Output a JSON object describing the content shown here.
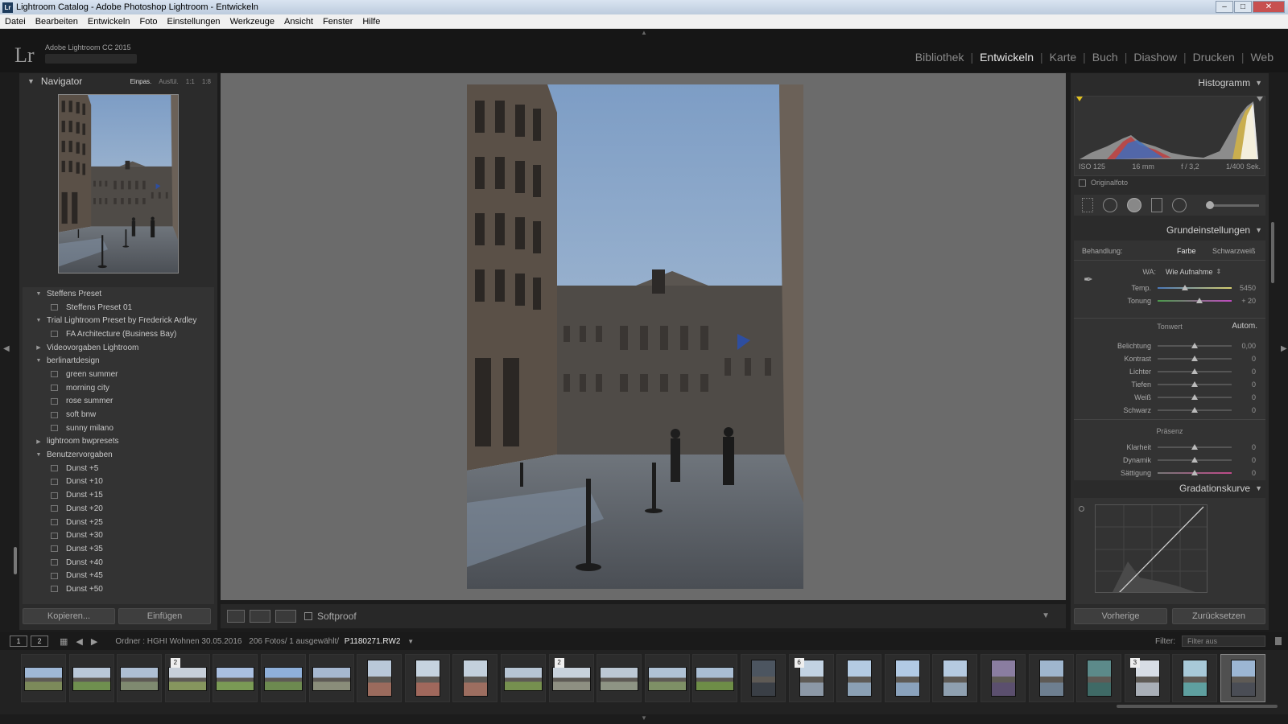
{
  "window": {
    "title": "Lightroom Catalog - Adobe Photoshop Lightroom - Entwickeln",
    "app_icon": "Lr"
  },
  "menu": [
    "Datei",
    "Bearbeiten",
    "Entwickeln",
    "Foto",
    "Einstellungen",
    "Werkzeuge",
    "Ansicht",
    "Fenster",
    "Hilfe"
  ],
  "identity": {
    "logo": "Lr",
    "version": "Adobe Lightroom CC 2015"
  },
  "modules": [
    {
      "label": "Bibliothek",
      "active": false
    },
    {
      "label": "Entwickeln",
      "active": true
    },
    {
      "label": "Karte",
      "active": false
    },
    {
      "label": "Buch",
      "active": false
    },
    {
      "label": "Diashow",
      "active": false
    },
    {
      "label": "Drucken",
      "active": false
    },
    {
      "label": "Web",
      "active": false
    }
  ],
  "navigator": {
    "title": "Navigator",
    "options": [
      "Einpas.",
      "Ausfül.",
      "1:1",
      "1:8"
    ]
  },
  "presets": [
    {
      "label": "Steffens Preset",
      "kind": "folder",
      "open": true
    },
    {
      "label": "Steffens Preset 01",
      "kind": "preset"
    },
    {
      "label": "Trial Lightroom Preset by Frederick Ardley",
      "kind": "folder",
      "open": true
    },
    {
      "label": "FA Architecture (Business Bay)",
      "kind": "preset"
    },
    {
      "label": "Videovorgaben Lightroom",
      "kind": "folder",
      "open": false
    },
    {
      "label": "berlinartdesign",
      "kind": "folder",
      "open": true
    },
    {
      "label": "green summer",
      "kind": "preset"
    },
    {
      "label": "morning city",
      "kind": "preset"
    },
    {
      "label": "rose summer",
      "kind": "preset"
    },
    {
      "label": "soft bnw",
      "kind": "preset"
    },
    {
      "label": "sunny milano",
      "kind": "preset"
    },
    {
      "label": "lightroom bwpresets",
      "kind": "folder",
      "open": false
    },
    {
      "label": "Benutzervorgaben",
      "kind": "folder",
      "open": true
    },
    {
      "label": "Dunst +5",
      "kind": "preset"
    },
    {
      "label": "Dunst +10",
      "kind": "preset"
    },
    {
      "label": "Dunst +15",
      "kind": "preset"
    },
    {
      "label": "Dunst +20",
      "kind": "preset"
    },
    {
      "label": "Dunst +25",
      "kind": "preset"
    },
    {
      "label": "Dunst +30",
      "kind": "preset"
    },
    {
      "label": "Dunst +35",
      "kind": "preset"
    },
    {
      "label": "Dunst +40",
      "kind": "preset"
    },
    {
      "label": "Dunst +45",
      "kind": "preset"
    },
    {
      "label": "Dunst +50",
      "kind": "preset"
    }
  ],
  "left_buttons": {
    "copy": "Kopieren...",
    "paste": "Einfügen"
  },
  "toolbar": {
    "softproof": "Softproof"
  },
  "histogram": {
    "title": "Histogramm",
    "iso": "ISO 125",
    "focal": "16 mm",
    "aperture": "f / 3,2",
    "shutter": "1/400 Sek.",
    "original": "Originalfoto"
  },
  "basic": {
    "title": "Grundeinstellungen",
    "treatment_label": "Behandlung:",
    "treatment_color": "Farbe",
    "treatment_bw": "Schwarzweiß",
    "wb_label": "WA:",
    "wb_value": "Wie Aufnahme",
    "tone_title": "Tonwert",
    "auto": "Autom.",
    "presence_title": "Präsenz",
    "sliders": [
      {
        "label": "Temp.",
        "value": "5450",
        "pos": 0.37
      },
      {
        "label": "Tonung",
        "value": "+ 20",
        "pos": 0.56
      },
      {
        "label": "Belichtung",
        "value": "0,00",
        "pos": 0.5
      },
      {
        "label": "Kontrast",
        "value": "0",
        "pos": 0.5
      },
      {
        "label": "Lichter",
        "value": "0",
        "pos": 0.5
      },
      {
        "label": "Tiefen",
        "value": "0",
        "pos": 0.5
      },
      {
        "label": "Weiß",
        "value": "0",
        "pos": 0.5
      },
      {
        "label": "Schwarz",
        "value": "0",
        "pos": 0.5
      },
      {
        "label": "Klarheit",
        "value": "0",
        "pos": 0.5
      },
      {
        "label": "Dynamik",
        "value": "0",
        "pos": 0.5
      },
      {
        "label": "Sättigung",
        "value": "0",
        "pos": 0.5
      }
    ]
  },
  "curve": {
    "title": "Gradationskurve"
  },
  "right_buttons": {
    "previous": "Vorherige",
    "reset": "Zurücksetzen"
  },
  "filmbar": {
    "page1": "1",
    "page2": "2",
    "source": "Ordner : HGHI Wohnen 30.05.2016",
    "count": "206 Fotos/ 1 ausgewählt/",
    "filename": "P1180271.RW2",
    "filter_label": "Filter:",
    "filter_value": "Filter aus"
  },
  "filmstrip": [
    {
      "kind": "land",
      "sky": "#9fb8d6",
      "ground": "#7c8a5a",
      "badge": ""
    },
    {
      "kind": "land",
      "sky": "#b9c7d8",
      "ground": "#6f8f4f",
      "badge": ""
    },
    {
      "kind": "land",
      "sky": "#aebfd4",
      "ground": "#7f8a70",
      "badge": ""
    },
    {
      "kind": "land",
      "sky": "#c7cfd9",
      "ground": "#86965e",
      "badge": "2"
    },
    {
      "kind": "land",
      "sky": "#a9bfe0",
      "ground": "#7a9a55",
      "badge": ""
    },
    {
      "kind": "land",
      "sky": "#8fb0da",
      "ground": "#6d8a50",
      "badge": ""
    },
    {
      "kind": "land",
      "sky": "#a6b8d0",
      "ground": "#8a8d7a",
      "badge": ""
    },
    {
      "kind": "port",
      "sky": "#b9c8d9",
      "ground": "#9b6b5d",
      "badge": ""
    },
    {
      "kind": "port",
      "sky": "#c6d3df",
      "ground": "#a0685c",
      "badge": ""
    },
    {
      "kind": "port",
      "sky": "#c3d0dc",
      "ground": "#9d6e60",
      "badge": ""
    },
    {
      "kind": "land",
      "sky": "#b7c5d4",
      "ground": "#76904f",
      "badge": ""
    },
    {
      "kind": "land",
      "sky": "#c8d2dc",
      "ground": "#8e8f82",
      "badge": "2"
    },
    {
      "kind": "land",
      "sky": "#bcc8d4",
      "ground": "#8e9484",
      "badge": ""
    },
    {
      "kind": "land",
      "sky": "#b0c2d5",
      "ground": "#7e9066",
      "badge": ""
    },
    {
      "kind": "land",
      "sky": "#a9bdd3",
      "ground": "#6e8d47",
      "badge": ""
    },
    {
      "kind": "port",
      "sky": "#4c5560",
      "ground": "#3a3f46",
      "badge": ""
    },
    {
      "kind": "port",
      "sky": "#c2d2e2",
      "ground": "#8c98a6",
      "badge": "6"
    },
    {
      "kind": "port",
      "sky": "#b4cbe2",
      "ground": "#8ba0b4",
      "badge": ""
    },
    {
      "kind": "port",
      "sky": "#b2cae4",
      "ground": "#8aa2bc",
      "badge": ""
    },
    {
      "kind": "port",
      "sky": "#b5cae0",
      "ground": "#8fa0b0",
      "badge": ""
    },
    {
      "kind": "port",
      "sky": "#8a7da0",
      "ground": "#5b4f6e",
      "badge": ""
    },
    {
      "kind": "port",
      "sky": "#9fb6ce",
      "ground": "#6e7f90",
      "badge": ""
    },
    {
      "kind": "port",
      "sky": "#5c8a8a",
      "ground": "#3f6a66",
      "badge": ""
    },
    {
      "kind": "port",
      "sky": "#d7dde5",
      "ground": "#a9afb7",
      "badge": "3"
    },
    {
      "kind": "port",
      "sky": "#a8c9d8",
      "ground": "#5fa0a0",
      "badge": ""
    },
    {
      "kind": "port",
      "sky": "#9cb6d3",
      "ground": "#4a4d55",
      "badge": "",
      "selected": true
    }
  ]
}
